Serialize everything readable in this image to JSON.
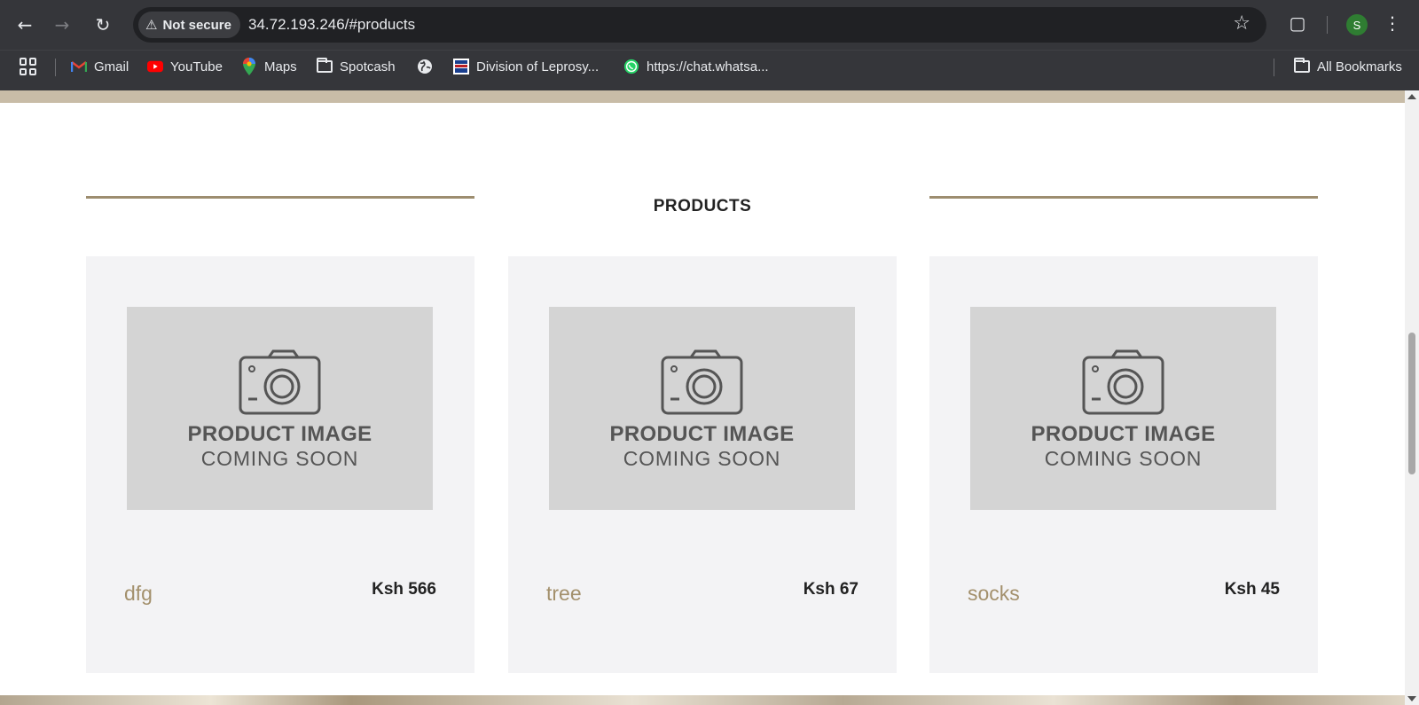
{
  "browser": {
    "security_label": "Not secure",
    "url": "34.72.193.246/#products",
    "avatar_initial": "S",
    "bookmarks": [
      {
        "label": "Gmail",
        "icon": "gmail-icon"
      },
      {
        "label": "YouTube",
        "icon": "youtube-icon"
      },
      {
        "label": "Maps",
        "icon": "maps-icon"
      },
      {
        "label": "Spotcash",
        "icon": "folder-icon"
      },
      {
        "label": "",
        "icon": "globe-icon"
      },
      {
        "label": "Division of Leprosy...",
        "icon": "site-favicon"
      },
      {
        "label": "https://chat.whatsa...",
        "icon": "whatsapp-icon"
      }
    ],
    "all_bookmarks_label": "All Bookmarks"
  },
  "page": {
    "section_title": "PRODUCTS",
    "placeholder_line1": "PRODUCT IMAGE",
    "placeholder_line2": "COMING SOON",
    "products": [
      {
        "name": "dfg",
        "price": "Ksh 566"
      },
      {
        "name": "tree",
        "price": "Ksh 67"
      },
      {
        "name": "socks",
        "price": "Ksh 45"
      }
    ],
    "colors": {
      "accent_rule": "#9d8d6f",
      "product_name": "#a3906c",
      "card_bg": "#f3f3f5",
      "placeholder_bg": "#d4d4d4"
    }
  }
}
